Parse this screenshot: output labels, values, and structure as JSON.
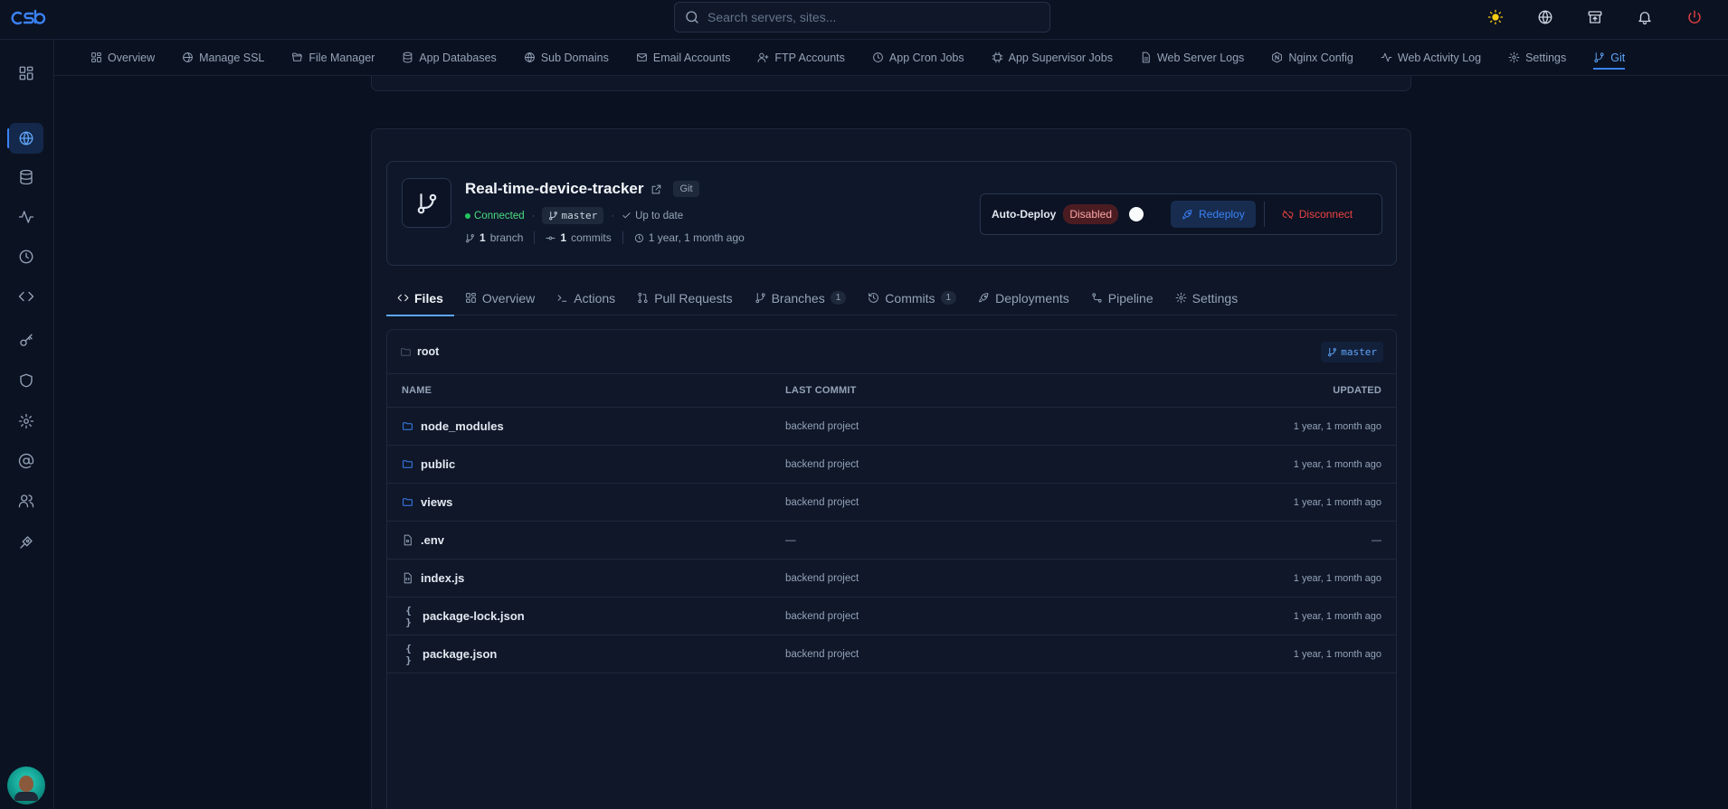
{
  "search": {
    "placeholder": "Search servers, sites..."
  },
  "nav": {
    "items": [
      {
        "label": "Overview"
      },
      {
        "label": "Manage SSL"
      },
      {
        "label": "File Manager"
      },
      {
        "label": "App Databases"
      },
      {
        "label": "Sub Domains"
      },
      {
        "label": "Email Accounts"
      },
      {
        "label": "FTP Accounts"
      },
      {
        "label": "App Cron Jobs"
      },
      {
        "label": "App Supervisor Jobs"
      },
      {
        "label": "Web Server Logs"
      },
      {
        "label": "Nginx Config"
      },
      {
        "label": "Web Activity Log"
      },
      {
        "label": "Settings"
      },
      {
        "label": "Git"
      }
    ],
    "active": "Git"
  },
  "repo": {
    "name": "Real-time-device-tracker",
    "provider_badge": "Git",
    "status": "Connected",
    "branch": "master",
    "sync_status": "Up to date",
    "branch_count": "1",
    "branch_word": "branch",
    "commit_count": "1",
    "commit_word": "commits",
    "age": "1 year, 1 month ago"
  },
  "deploy": {
    "label": "Auto-Deploy",
    "state": "Disabled",
    "redeploy_label": "Redeploy",
    "disconnect_label": "Disconnect"
  },
  "tabs": [
    {
      "label": "Files",
      "icon": "code-icon"
    },
    {
      "label": "Overview",
      "icon": "grid-icon"
    },
    {
      "label": "Actions",
      "icon": "terminal-icon"
    },
    {
      "label": "Pull Requests",
      "icon": "pull-request-icon"
    },
    {
      "label": "Branches",
      "icon": "branch-icon",
      "count": "1"
    },
    {
      "label": "Commits",
      "icon": "history-icon",
      "count": "1"
    },
    {
      "label": "Deployments",
      "icon": "rocket-icon"
    },
    {
      "label": "Pipeline",
      "icon": "pipeline-icon"
    },
    {
      "label": "Settings",
      "icon": "gear-icon"
    }
  ],
  "files": {
    "path": "root",
    "branch": "master",
    "headers": {
      "name": "NAME",
      "commit": "LAST COMMIT",
      "updated": "UPDATED"
    },
    "rows": [
      {
        "name": "node_modules",
        "type": "folder",
        "commit": "backend project",
        "updated": "1 year, 1 month ago"
      },
      {
        "name": "public",
        "type": "folder",
        "commit": "backend project",
        "updated": "1 year, 1 month ago"
      },
      {
        "name": "views",
        "type": "folder",
        "commit": "backend project",
        "updated": "1 year, 1 month ago"
      },
      {
        "name": ".env",
        "type": "file",
        "commit": "—",
        "updated": "—"
      },
      {
        "name": "index.js",
        "type": "code-file",
        "commit": "backend project",
        "updated": "1 year, 1 month ago"
      },
      {
        "name": "package-lock.json",
        "type": "json",
        "commit": "backend project",
        "updated": "1 year, 1 month ago"
      },
      {
        "name": "package.json",
        "type": "json",
        "commit": "backend project",
        "updated": "1 year, 1 month ago"
      }
    ]
  },
  "colors": {
    "accent": "#3b82f6",
    "success": "#22c55e",
    "danger": "#ef4444",
    "bg": "#0a1120"
  }
}
